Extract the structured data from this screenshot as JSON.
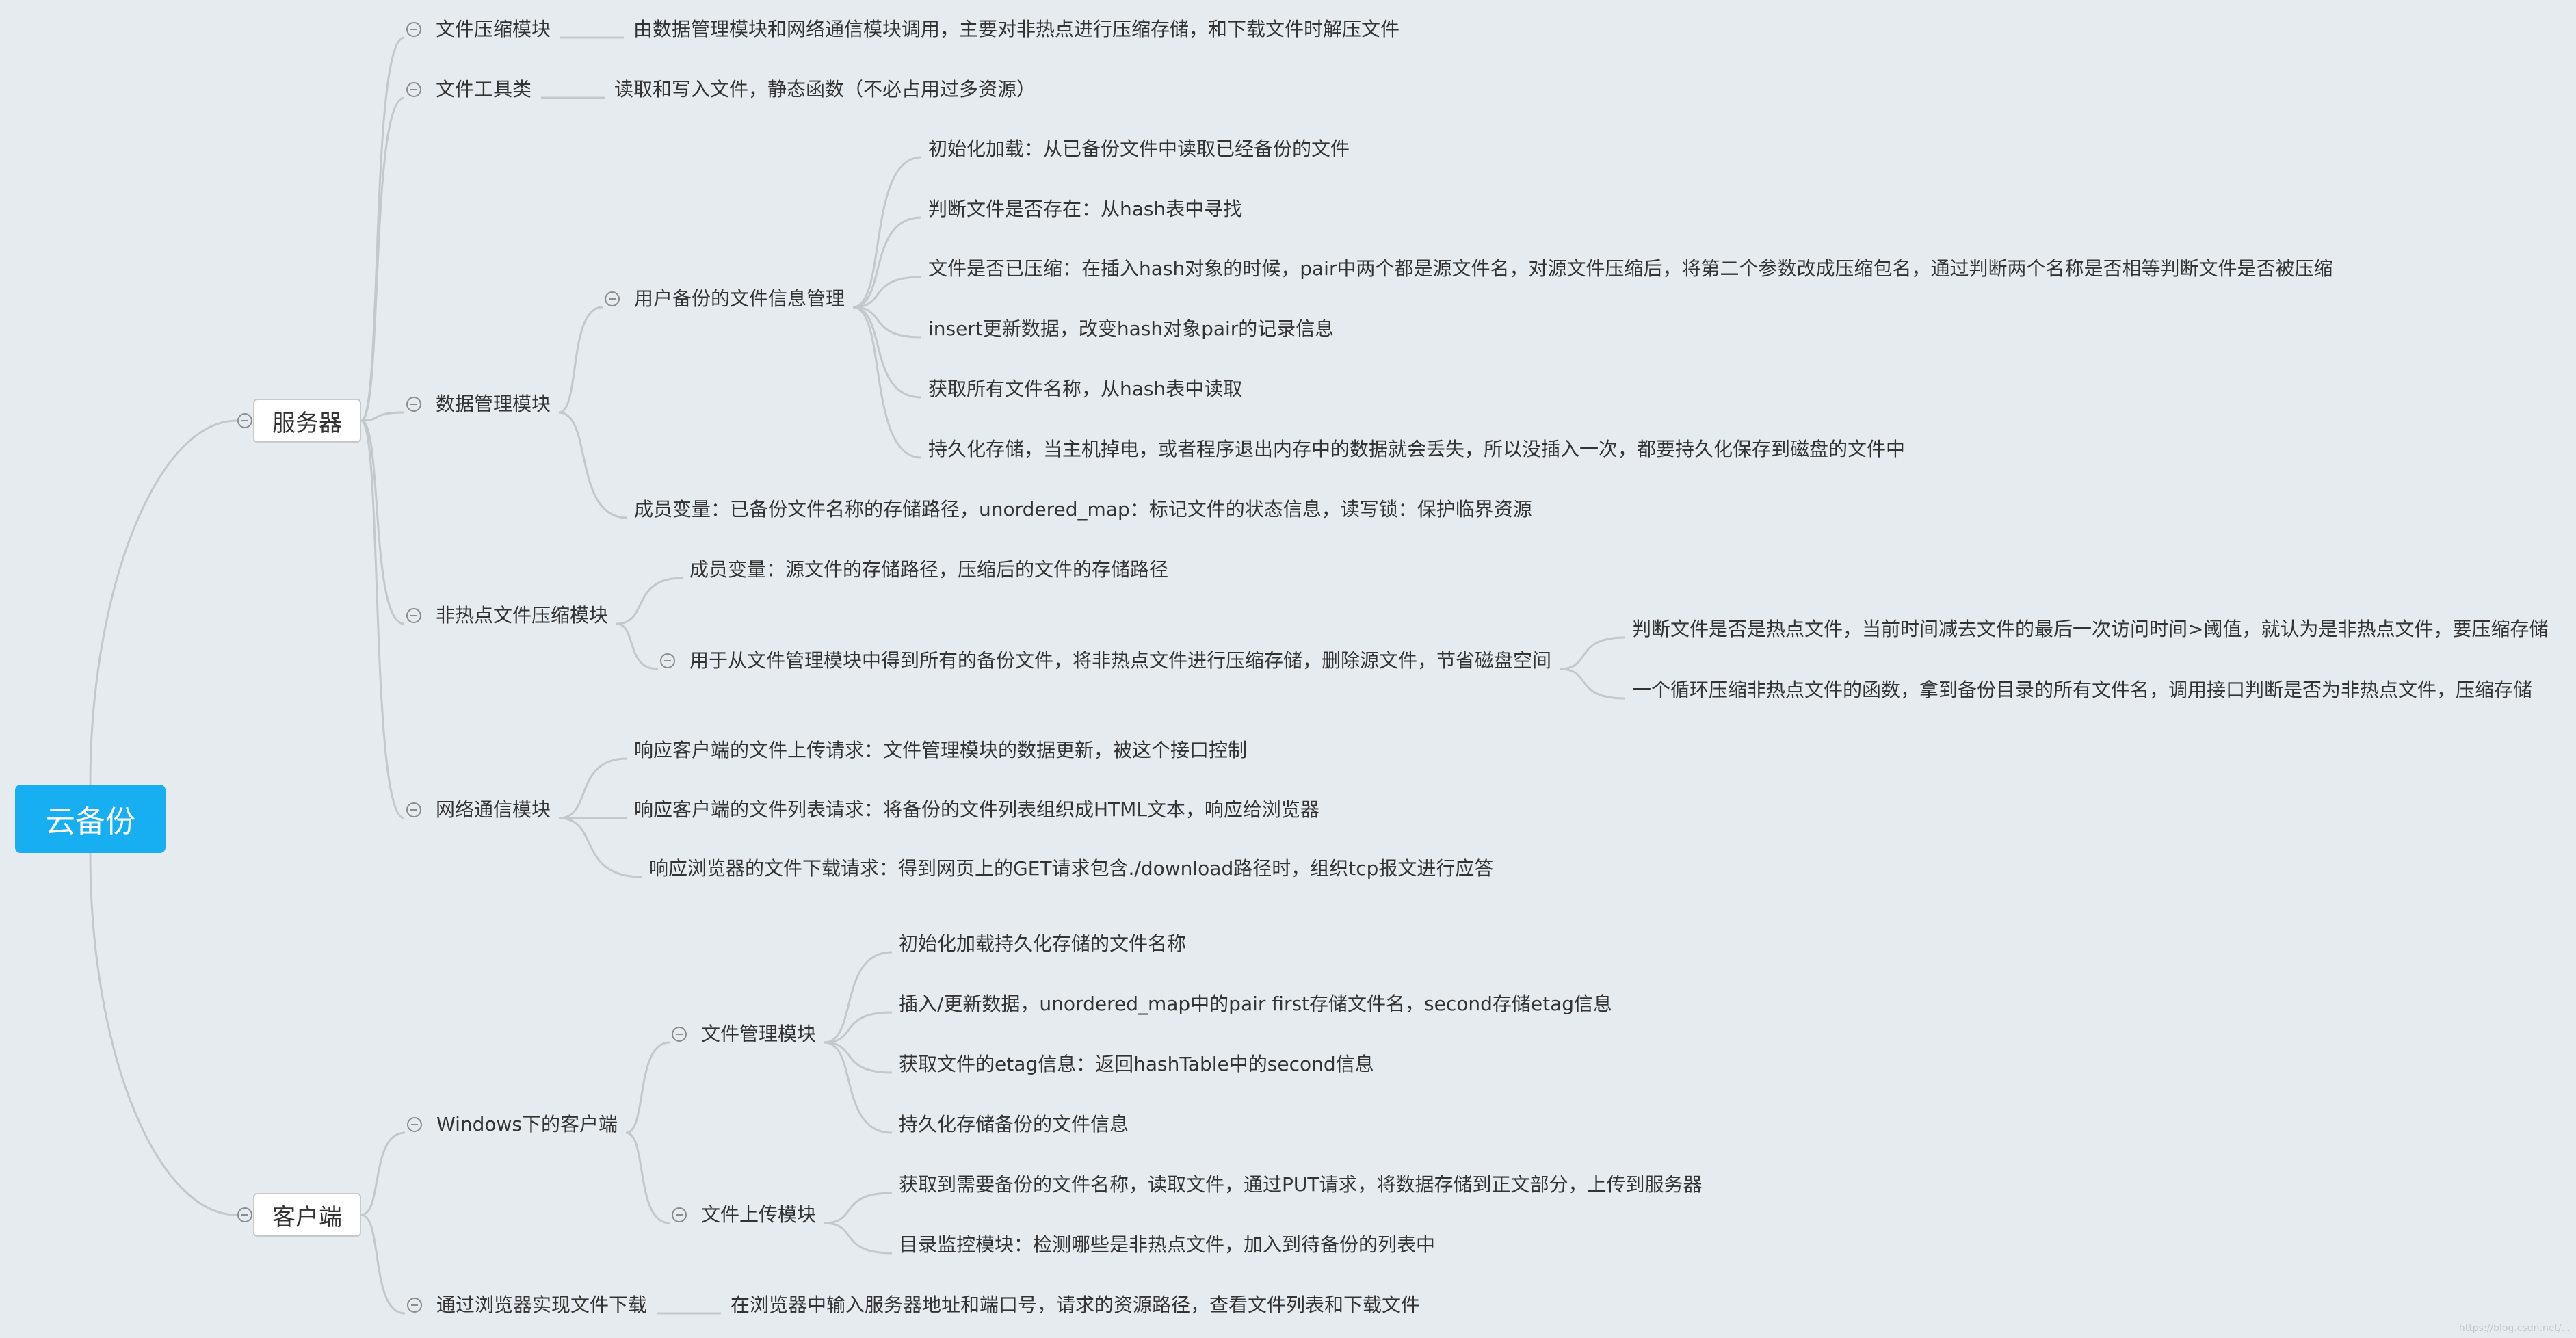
{
  "root": "云备份",
  "nodes": [
    {
      "id": "server",
      "text": "服务器"
    },
    {
      "id": "client",
      "text": "客户端"
    },
    {
      "id": "s_compress",
      "text": "文件压缩模块"
    },
    {
      "id": "s_compress_d",
      "text": "由数据管理模块和网络通信模块调用，主要对非热点进行压缩存储，和下载文件时解压文件"
    },
    {
      "id": "s_tool",
      "text": "文件工具类"
    },
    {
      "id": "s_tool_d",
      "text": "读取和写入文件，静态函数（不必占用过多资源）"
    },
    {
      "id": "s_data",
      "text": "数据管理模块"
    },
    {
      "id": "s_data_user",
      "text": "用户备份的文件信息管理"
    },
    {
      "id": "s_data_u1",
      "text": "初始化加载：从已备份文件中读取已经备份的文件"
    },
    {
      "id": "s_data_u2",
      "text": "判断文件是否存在：从hash表中寻找"
    },
    {
      "id": "s_data_u3",
      "text": "文件是否已压缩：在插入hash对象的时候，pair中两个都是源文件名，对源文件压缩后，将第二个参数改成压缩包名，通过判断两个名称是否相等判断文件是否被压缩"
    },
    {
      "id": "s_data_u4",
      "text": "insert更新数据，改变hash对象pair的记录信息"
    },
    {
      "id": "s_data_u5",
      "text": "获取所有文件名称，从hash表中读取"
    },
    {
      "id": "s_data_u6",
      "text": "持久化存储，当主机掉电，或者程序退出内存中的数据就会丢失，所以没插入一次，都要持久化保存到磁盘的文件中"
    },
    {
      "id": "s_data_m",
      "text": "成员变量：已备份文件名称的存储路径，unordered_map：标记文件的状态信息，读写锁：保护临界资源"
    },
    {
      "id": "s_hot",
      "text": "非热点文件压缩模块"
    },
    {
      "id": "s_hot_m",
      "text": "成员变量：源文件的存储路径，压缩后的文件的存储路径"
    },
    {
      "id": "s_hot_f",
      "text": "用于从文件管理模块中得到所有的备份文件，将非热点文件进行压缩存储，删除源文件，节省磁盘空间"
    },
    {
      "id": "s_hot_f1",
      "text": "判断文件是否是热点文件，当前时间减去文件的最后一次访问时间>阈值，就认为是非热点文件，要压缩存储"
    },
    {
      "id": "s_hot_f2",
      "text": "一个循环压缩非热点文件的函数，拿到备份目录的所有文件名，调用接口判断是否为非热点文件，压缩存储"
    },
    {
      "id": "s_net",
      "text": "网络通信模块"
    },
    {
      "id": "s_net_1",
      "text": "响应客户端的文件上传请求：文件管理模块的数据更新，被这个接口控制"
    },
    {
      "id": "s_net_2",
      "text": "响应客户端的文件列表请求：将备份的文件列表组织成HTML文本，响应给浏览器"
    },
    {
      "id": "s_net_3",
      "text": "响应浏览器的文件下载请求：得到网页上的GET请求包含./download路径时，组织tcp报文进行应答"
    },
    {
      "id": "c_win",
      "text": "Windows下的客户端"
    },
    {
      "id": "c_fm",
      "text": "文件管理模块"
    },
    {
      "id": "c_fm_1",
      "text": "初始化加载持久化存储的文件名称"
    },
    {
      "id": "c_fm_2",
      "text": "插入/更新数据，unordered_map中的pair first存储文件名，second存储etag信息"
    },
    {
      "id": "c_fm_3",
      "text": "获取文件的etag信息：返回hashTable中的second信息"
    },
    {
      "id": "c_fm_4",
      "text": "持久化存储备份的文件信息"
    },
    {
      "id": "c_up",
      "text": "文件上传模块"
    },
    {
      "id": "c_up_1",
      "text": "获取到需要备份的文件名称，读取文件，通过PUT请求，将数据存储到正文部分，上传到服务器"
    },
    {
      "id": "c_up_2",
      "text": "目录监控模块：检测哪些是非热点文件，加入到待备份的列表中"
    },
    {
      "id": "c_browser",
      "text": "通过浏览器实现文件下载"
    },
    {
      "id": "c_browser_d",
      "text": "在浏览器中输入服务器地址和端口号，请求的资源路径，查看文件列表和下载文件"
    }
  ],
  "watermark": "https://blog.csdn.net/..."
}
